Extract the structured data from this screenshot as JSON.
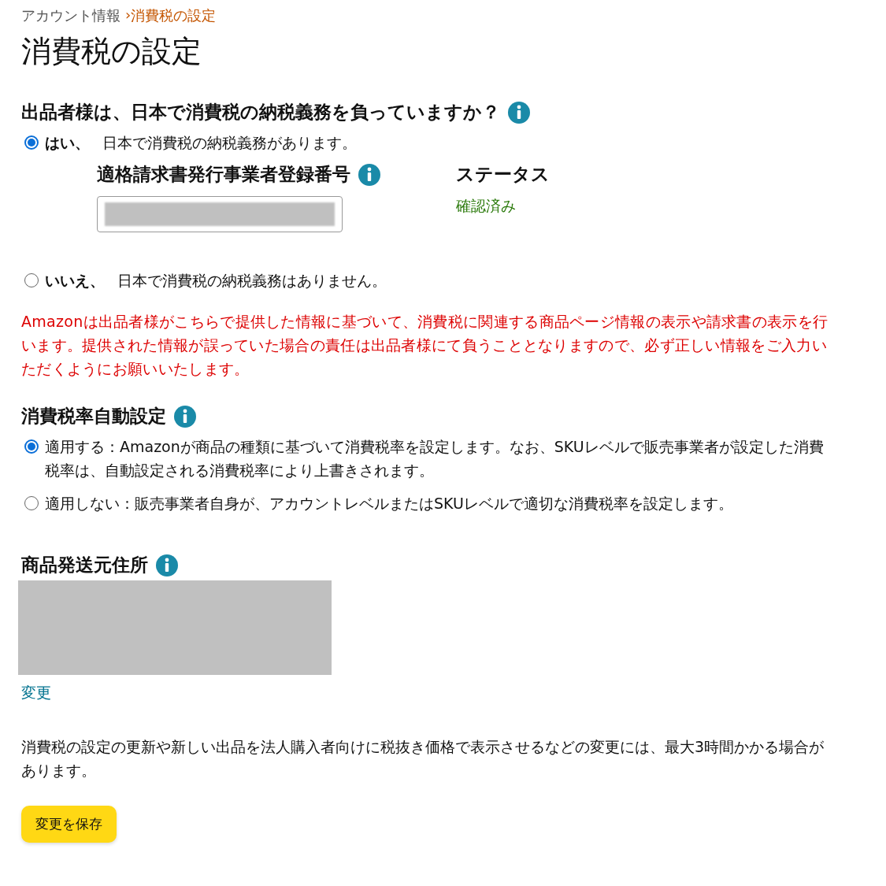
{
  "breadcrumb": {
    "parent": "アカウント情報",
    "separator": "›",
    "current": "消費税の設定"
  },
  "title": "消費税の設定",
  "tax_obligation": {
    "heading": "出品者様は、日本で消費税の納税義務を負っていますか？",
    "options": [
      {
        "label": "はい、",
        "description": "日本で消費税の納税義務があります。",
        "selected": true,
        "registration": {
          "label": "適格請求書発行事業者登録番号",
          "status_label": "ステータス",
          "status_value": "確認済み"
        }
      },
      {
        "label": "いいえ、",
        "description": "日本で消費税の納税義務はありません。",
        "selected": false
      }
    ]
  },
  "notice": "Amazonは出品者様がこちらで提供した情報に基づいて、消費税に関連する商品ページ情報の表示や請求書の表示を行います。提供された情報が誤っていた場合の責任は出品者様にて負うこととなりますので、必ず正しい情報をご入力いただくようにお願いいたします。",
  "auto_tax_rate": {
    "heading": "消費税率自動設定",
    "options": [
      {
        "label": "適用する：Amazonが商品の種類に基づいて消費税率を設定します。なお、SKUレベルで販売事業者が設定した消費税率は、自動設定される消費税率により上書きされます。",
        "selected": true
      },
      {
        "label": "適用しない：販売事業者自身が、アカウントレベルまたはSKUレベルで適切な消費税率を設定します。",
        "selected": false
      }
    ]
  },
  "ship_from": {
    "heading": "商品発送元住所",
    "change_link": "変更"
  },
  "note": "消費税の設定の更新や新しい出品を法人購入者向けに税抜き価格で表示させるなどの変更には、最大3時間かかる場合があります。",
  "save_button": "変更を保存"
}
